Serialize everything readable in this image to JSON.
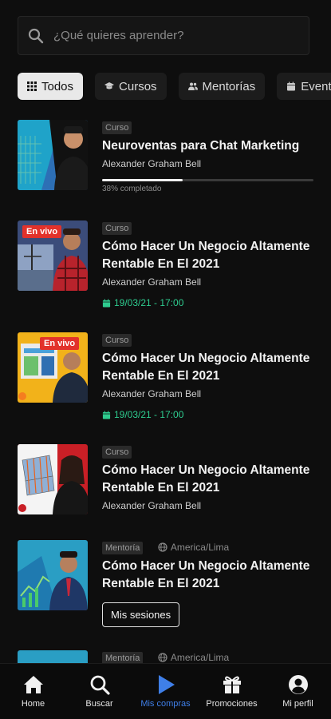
{
  "search": {
    "placeholder": "¿Qué quieres aprender?"
  },
  "filters": [
    {
      "label": "Todos",
      "icon": "grid-icon",
      "active": true
    },
    {
      "label": "Cursos",
      "icon": "graduation-cap-icon"
    },
    {
      "label": "Mentorías",
      "icon": "users-icon"
    },
    {
      "label": "Eventos",
      "icon": "calendar-icon"
    }
  ],
  "items": [
    {
      "tag": "Curso",
      "title": "Neuroventas para Chat Marketing",
      "author": "Alexander Graham Bell",
      "progress": 0.38,
      "progress_text": "38% completado"
    },
    {
      "tag": "Curso",
      "title": "Cómo Hacer Un Negocio Altamente Rentable En El 2021",
      "author": "Alexander Graham Bell",
      "date": "19/03/21 - 17:00",
      "badge": "En vivo"
    },
    {
      "tag": "Curso",
      "title": "Cómo Hacer Un Negocio Altamente Rentable En El 2021",
      "author": "Alexander Graham Bell",
      "date": "19/03/21 - 17:00",
      "badge": "En vivo"
    },
    {
      "tag": "Curso",
      "title": "Cómo Hacer Un Negocio Altamente Rentable En El 2021",
      "author": "Alexander Graham Bell"
    },
    {
      "tag": "Mentoría",
      "timezone": "America/Lima",
      "title": "Cómo Hacer Un Negocio Altamente Rentable En El 2021",
      "button": "Mis sesiones"
    },
    {
      "tag": "Mentoría",
      "timezone": "America/Lima"
    }
  ],
  "nav": [
    {
      "label": "Home",
      "icon": "home-icon"
    },
    {
      "label": "Buscar",
      "icon": "search-icon"
    },
    {
      "label": "Mis compras",
      "icon": "play-icon",
      "active": true
    },
    {
      "label": "Promociones",
      "icon": "gift-icon"
    },
    {
      "label": "Mi perfil",
      "icon": "user-circle-icon"
    }
  ],
  "colors": {
    "background": "#0e0e0e",
    "accent": "#3f7fe8",
    "date": "#2ecc8f",
    "live_badge": "#e2322b"
  }
}
